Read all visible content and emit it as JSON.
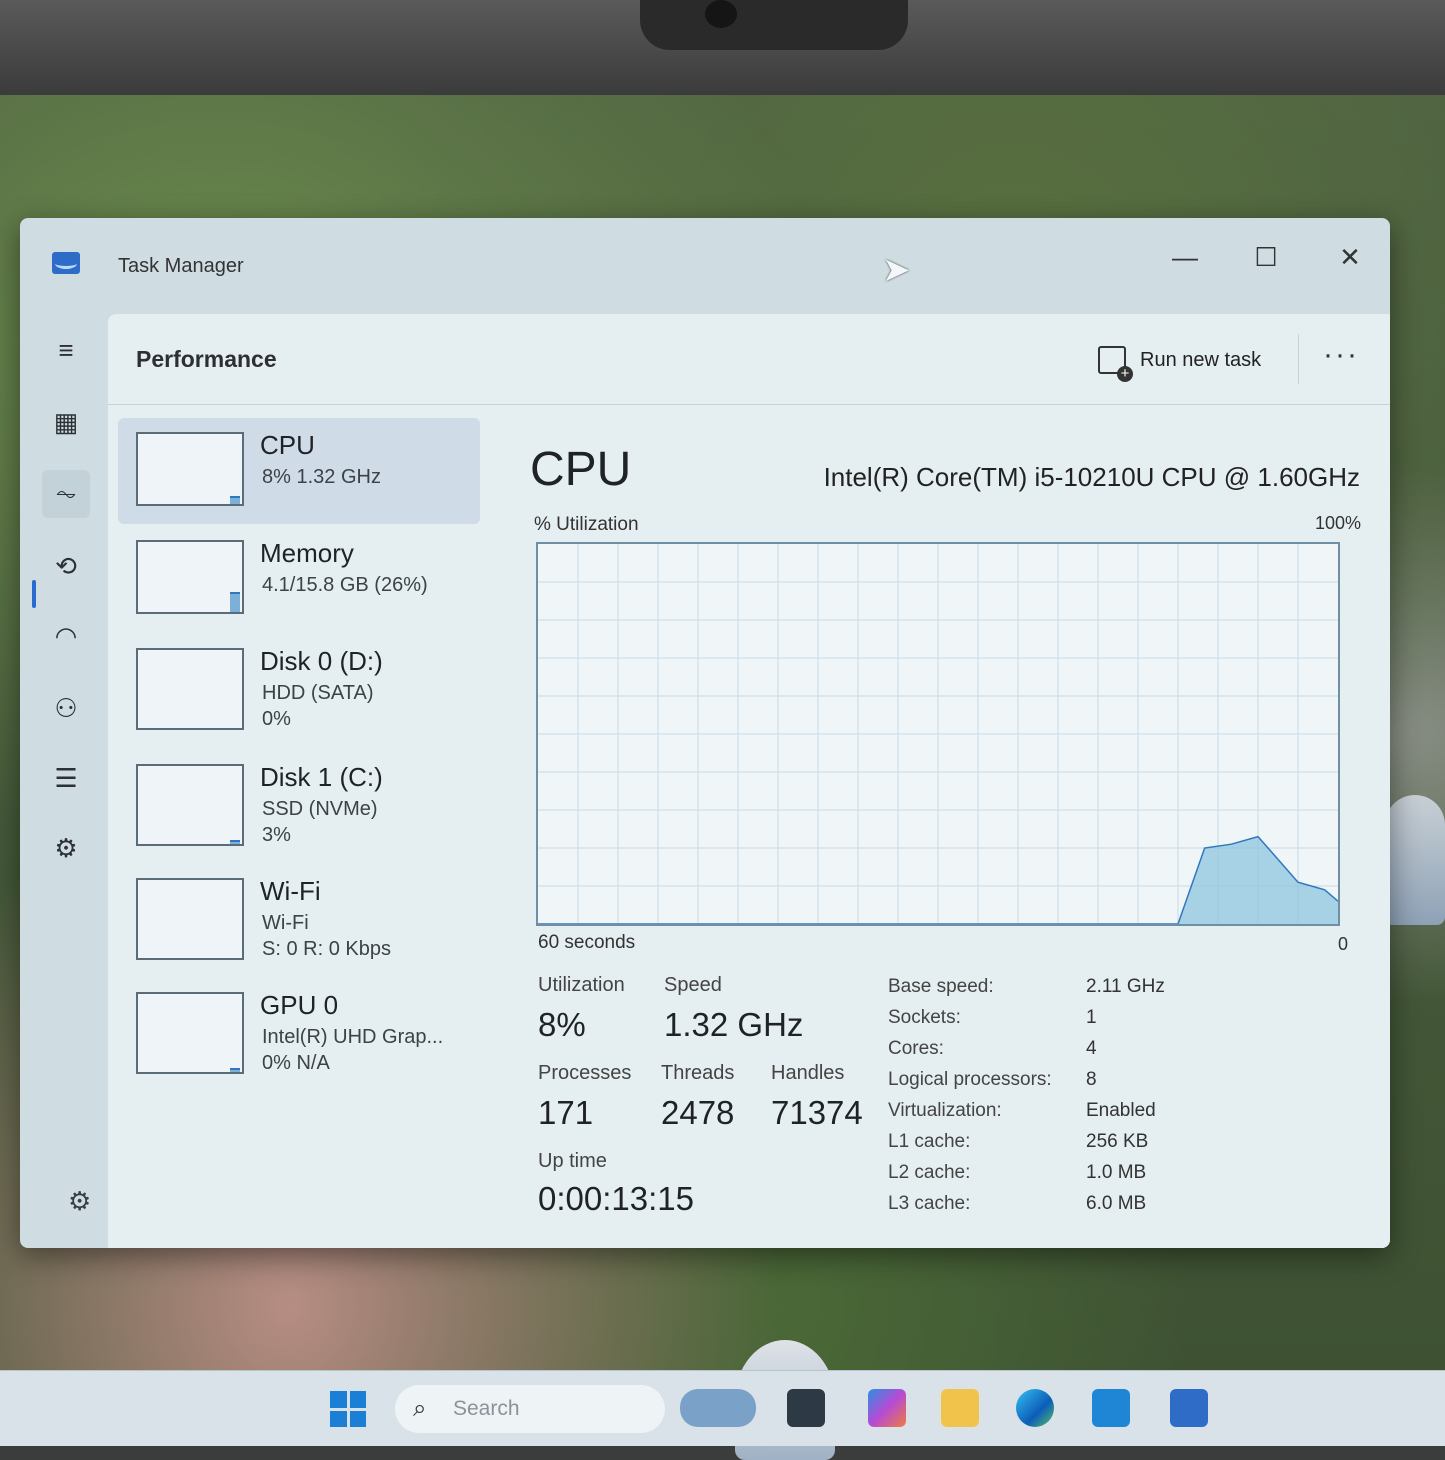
{
  "window": {
    "title": "Task Manager",
    "minimize": "—",
    "maximize": "☐",
    "close": "✕"
  },
  "header": {
    "page_title": "Performance",
    "run_new_task": "Run new task",
    "more": "···"
  },
  "nav": {
    "items": [
      {
        "name": "menu",
        "glyph": "≡"
      },
      {
        "name": "processes",
        "glyph": "▦"
      },
      {
        "name": "performance",
        "glyph": "⏦"
      },
      {
        "name": "app-history",
        "glyph": "⟲"
      },
      {
        "name": "startup-apps",
        "glyph": "◠"
      },
      {
        "name": "users",
        "glyph": "⚇"
      },
      {
        "name": "details",
        "glyph": "☰"
      },
      {
        "name": "services",
        "glyph": "⚙"
      }
    ],
    "settings_glyph": "⚙"
  },
  "devices": [
    {
      "name": "CPU",
      "sub1": "8%  1.32 GHz",
      "sub2": "",
      "fill": 0.08
    },
    {
      "name": "Memory",
      "sub1": "4.1/15.8 GB (26%)",
      "sub2": "",
      "fill": 0.26
    },
    {
      "name": "Disk 0 (D:)",
      "sub1": "HDD (SATA)",
      "sub2": "0%",
      "fill": 0.0
    },
    {
      "name": "Disk 1 (C:)",
      "sub1": "SSD (NVMe)",
      "sub2": "3%",
      "fill": 0.03
    },
    {
      "name": "Wi-Fi",
      "sub1": "Wi-Fi",
      "sub2": "S: 0  R: 0 Kbps",
      "fill": 0.0
    },
    {
      "name": "GPU 0",
      "sub1": "Intel(R) UHD Grap...",
      "sub2": "0%  N/A",
      "fill": 0.02
    }
  ],
  "cpu": {
    "title": "CPU",
    "model": "Intel(R) Core(TM) i5-10210U CPU @ 1.60GHz",
    "util_label": "% Utilization",
    "max_label": "100%",
    "axis_left": "60 seconds",
    "axis_right": "0",
    "stats": {
      "utilization_label": "Utilization",
      "utilization": "8%",
      "speed_label": "Speed",
      "speed": "1.32 GHz",
      "processes_label": "Processes",
      "processes": "171",
      "threads_label": "Threads",
      "threads": "2478",
      "handles_label": "Handles",
      "handles": "71374",
      "uptime_label": "Up time",
      "uptime": "0:00:13:15"
    },
    "specs": [
      {
        "key": "Base speed:",
        "value": "2.11 GHz"
      },
      {
        "key": "Sockets:",
        "value": "1"
      },
      {
        "key": "Cores:",
        "value": "4"
      },
      {
        "key": "Logical processors:",
        "value": "8"
      },
      {
        "key": "Virtualization:",
        "value": "Enabled"
      },
      {
        "key": "L1 cache:",
        "value": "256 KB"
      },
      {
        "key": "L2 cache:",
        "value": "1.0 MB"
      },
      {
        "key": "L3 cache:",
        "value": "6.0 MB"
      }
    ]
  },
  "chart_data": {
    "type": "area",
    "x": [
      0,
      48,
      50,
      52,
      54,
      55,
      57,
      59,
      60
    ],
    "values": [
      0,
      0,
      20,
      21,
      23,
      19,
      11,
      9,
      6
    ],
    "ylim": [
      0,
      100
    ],
    "xlim": [
      0,
      60
    ],
    "grid": true
  },
  "taskbar": {
    "search_placeholder": "Search",
    "search_glyph": "⌕"
  },
  "colors": {
    "accent": "#2a6bd1",
    "graph_line": "#2f78c0",
    "graph_fill": "#8fc4de",
    "window_bg": "#e5eef1"
  }
}
